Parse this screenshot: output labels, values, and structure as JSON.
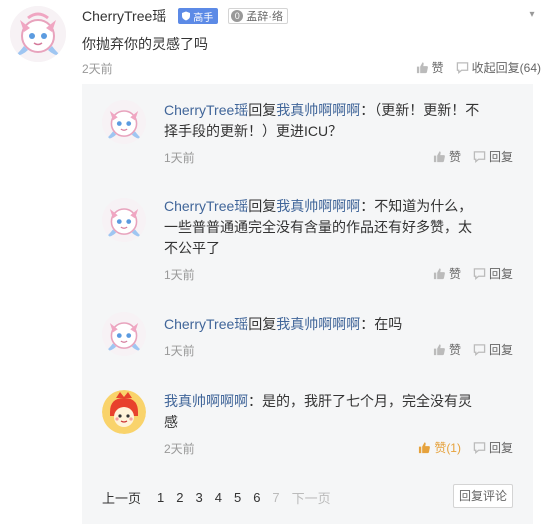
{
  "main": {
    "username": "CherryTree瑶",
    "badge_master": "高手",
    "badge_group_num": "0",
    "badge_group": "孟辞·络",
    "more": "▾",
    "text": "你抛弃你的灵感了吗",
    "time": "2天前",
    "like_label": "赞",
    "collapse_label": "收起回复(64)"
  },
  "replies": [
    {
      "name": "CherryTree瑶",
      "reply_word": "回复",
      "target": "我真帅啊啊啊",
      "text": "：（更新！更新！不择手段的更新！）更进ICU？",
      "time": "1天前",
      "like_label": "赞",
      "reply_label": "回复"
    },
    {
      "name": "CherryTree瑶",
      "reply_word": "回复",
      "target": "我真帅啊啊啊",
      "text": "：不知道为什么，一些普普通通完全没有含量的作品还有好多赞，太不公平了",
      "time": "1天前",
      "like_label": "赞",
      "reply_label": "回复"
    },
    {
      "name": "CherryTree瑶",
      "reply_word": "回复",
      "target": "我真帅啊啊啊",
      "text": "：在吗",
      "time": "1天前",
      "like_label": "赞",
      "reply_label": "回复"
    },
    {
      "name": "我真帅啊啊啊",
      "text": "：是的，我肝了七个月，完全没有灵感",
      "time": "2天前",
      "like_label": "赞(1)",
      "reply_label": "回复"
    }
  ],
  "pager": {
    "prev": "上一页",
    "pages": [
      "1",
      "2",
      "3",
      "4",
      "5",
      "6",
      "7"
    ],
    "next": "下一页",
    "reply_button": "回复评论"
  },
  "colors": {
    "link": "#406599",
    "liked": "#e6a23c",
    "badge": "#5c8ae6",
    "panel": "#f5f6f7"
  },
  "icons": {
    "avatar_cherry": "cartoon-avatar",
    "avatar_red": "red-cartoon-avatar",
    "like": "thumbs-up-icon",
    "reply": "comment-icon"
  }
}
